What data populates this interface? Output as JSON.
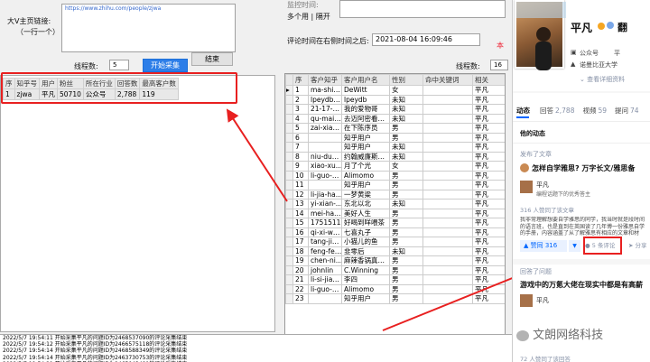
{
  "form": {
    "main_link_label": "大V主页链接:",
    "main_link_hint": "（一行一个）",
    "main_link_value": "https://www.zhihu.com/people/zjwa",
    "threads_label_left": "线程数:",
    "threads_value_left": "5",
    "start_collect_button": "开始采集",
    "end_button": "结束",
    "monitor_label": "监控时间:",
    "separator_options": "多个用 | 隔开",
    "comment_time_label": "评论时间在右侧时间之后:",
    "comment_time_value": "2021-08-04 16:09:46",
    "note_partial": "本",
    "threads_label_right": "线程数:",
    "threads_value_right": "16"
  },
  "user_table": {
    "headers": [
      "序",
      "知乎号",
      "用户",
      "粉丝",
      "所在行业",
      "回答数",
      "最高客户数"
    ],
    "rows": [
      [
        "1",
        "zjwa",
        "平凡",
        "50710",
        "公众号",
        "2,788",
        "119"
      ]
    ]
  },
  "comment_table": {
    "headers": [
      "序",
      "客户知乎",
      "客户用户名",
      "性别",
      "命中关键词",
      "相关"
    ],
    "rows": [
      [
        "1",
        "ma-shi…",
        "DeWitt",
        "女",
        "",
        "平凡"
      ],
      [
        "2",
        "lpeydb…",
        "lpeydb",
        "未知",
        "",
        "平凡"
      ],
      [
        "3",
        "21-17-…",
        "我的爱物哥",
        "未知",
        "",
        "平凡"
      ],
      [
        "4",
        "qu-mai…",
        "去迈阿密看…",
        "未知",
        "",
        "平凡"
      ],
      [
        "5",
        "zai-xia…",
        "在下陈序员",
        "男",
        "",
        "平凡"
      ],
      [
        "6",
        "",
        "知乎用户",
        "男",
        "",
        "平凡"
      ],
      [
        "7",
        "",
        "知乎用户",
        "未知",
        "",
        "平凡"
      ],
      [
        "8",
        "niu-du…",
        "约翰威廉斯…",
        "未知",
        "",
        "平凡"
      ],
      [
        "9",
        "xiao-xu…",
        "月了个光",
        "女",
        "",
        "平凡"
      ],
      [
        "10",
        "li-guo-…",
        "Alimomo",
        "男",
        "",
        "平凡"
      ],
      [
        "11",
        "",
        "知乎用户",
        "男",
        "",
        "平凡"
      ],
      [
        "12",
        "li-jia-ha…",
        "一梦黄粱",
        "男",
        "",
        "平凡"
      ],
      [
        "13",
        "yi-xian-…",
        "东北以北",
        "未知",
        "",
        "平凡"
      ],
      [
        "14",
        "mei-ha…",
        "美好人生",
        "男",
        "",
        "平凡"
      ],
      [
        "15",
        "1751511",
        "好喝到咩喂茶",
        "男",
        "",
        "平凡"
      ],
      [
        "16",
        "qi-xi-w…",
        "七喜丸子",
        "男",
        "",
        "平凡"
      ],
      [
        "17",
        "tang-ji…",
        "小猫儿的鱼",
        "男",
        "",
        "平凡"
      ],
      [
        "18",
        "feng-fe…",
        "韭零后",
        "未知",
        "",
        "平凡"
      ],
      [
        "19",
        "chen-ni…",
        "麻辣香锅真…",
        "男",
        "",
        "平凡"
      ],
      [
        "20",
        "johnlin",
        "C.Winning",
        "男",
        "",
        "平凡"
      ],
      [
        "21",
        "li-si-jia…",
        "李四",
        "男",
        "",
        "平凡"
      ],
      [
        "22",
        "li-guo-…",
        "Alimomo",
        "男",
        "",
        "平凡"
      ],
      [
        "23",
        "",
        "知乎用户",
        "男",
        "",
        "平凡"
      ]
    ]
  },
  "log": [
    "2022/5/7 19:54:11 开始采集平凡的问题ID为2468537090的评论采集结束",
    "2022/5/7 19:54:12 开始采集平凡的问题ID为2466575118的评论采集结束",
    "2022/5/7 19:54:14 开始采集平凡的问题ID为2468588349的评论采集结束",
    "2022/5/7 19:54:14 开始采集平凡的问题ID为2463730753的评论采集结束",
    "2022/5/7 19:54:21 开始采集平凡的问题ID为2465043481的评论采集结束"
  ],
  "zhihu": {
    "username": "平凡",
    "name_suffix": "翻",
    "info1_a": "公众号",
    "info1_b": "平",
    "info2": "诺曼比亚大学",
    "profile_link": "查看详细资料",
    "tabs": [
      {
        "label": "动态",
        "count": ""
      },
      {
        "label": "回答",
        "count": "2,788"
      },
      {
        "label": "视频",
        "count": "59"
      },
      {
        "label": "提问",
        "count": "74"
      }
    ],
    "feed_header": "他的动态",
    "post1_meta": "发布了文章",
    "post1_title": "怎样自学雅思? 万字长文/雅思备",
    "post1_author": "平凡",
    "post1_author_desc": "编程话题下的优秀答主",
    "post1_likes_line": "316 人赞同了该文章",
    "post1_body": "我非常理解想要自学雅思的同学，我当时就是段时间的语言班，也是直到在英国读了几年博一份雅思自学的手册，内容涵盖了从了解雅思有相应的文章和材料，大家可以按需获取。(",
    "upvote_label": "赞同 316",
    "downvote_label": "▼",
    "comment_label": "5 条评论",
    "share_label": "分享",
    "post2_meta": "回答了问题",
    "post2_title": "游戏中的万氪大佬在现实中都是有高薪",
    "post2_author": "平凡",
    "post2_bottom": "72 人赞同了该回答",
    "watermark": "文朗网络科技"
  },
  "colors": {
    "annotation_red": "#e82020",
    "zhihu_blue": "#0066ff",
    "button_blue": "#2d7ee8"
  }
}
